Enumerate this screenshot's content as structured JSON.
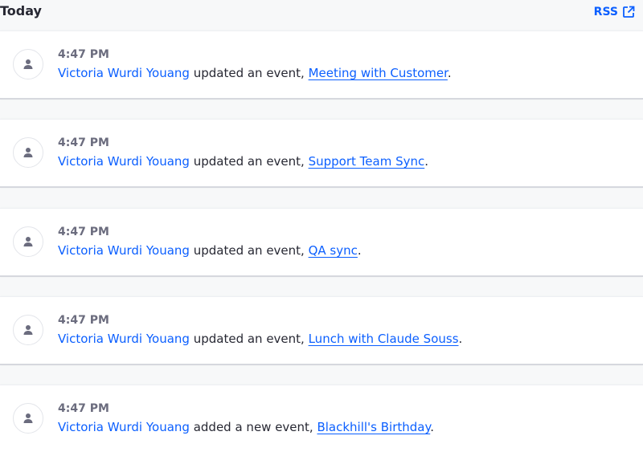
{
  "header": {
    "title": "Today",
    "rss_label": "RSS"
  },
  "colors": {
    "link": "#0b5fff",
    "time": "#6b6c7e",
    "text": "#272833"
  },
  "icons": {
    "avatar": "user-icon",
    "rss": "external-link-icon"
  },
  "activities": [
    {
      "time": "4:47 PM",
      "user": "Victoria Wurdi Youang",
      "action": " updated an event, ",
      "event": "Meeting with Customer",
      "end": "."
    },
    {
      "time": "4:47 PM",
      "user": "Victoria Wurdi Youang",
      "action": " updated an event, ",
      "event": "Support Team Sync",
      "end": "."
    },
    {
      "time": "4:47 PM",
      "user": "Victoria Wurdi Youang",
      "action": " updated an event, ",
      "event": "QA sync",
      "end": "."
    },
    {
      "time": "4:47 PM",
      "user": "Victoria Wurdi Youang",
      "action": " updated an event, ",
      "event": "Lunch with Claude Souss",
      "end": "."
    },
    {
      "time": "4:47 PM",
      "user": "Victoria Wurdi Youang",
      "action": " added a new event, ",
      "event": "Blackhill's Birthday",
      "end": "."
    }
  ]
}
